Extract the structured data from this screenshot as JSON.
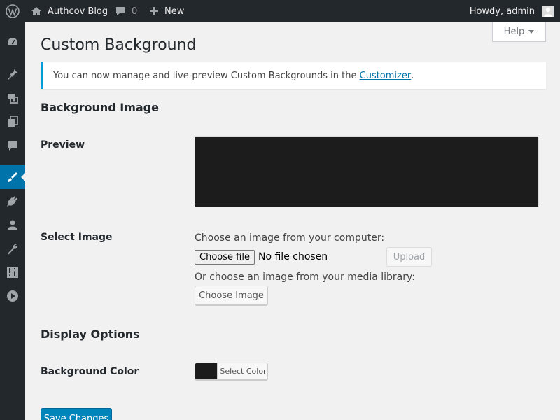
{
  "adminbar": {
    "site_name": "Authcov Blog",
    "comments_count": "0",
    "new_label": "New",
    "howdy": "Howdy, admin"
  },
  "sidebar": {
    "items": [
      {
        "icon": "dashboard-icon"
      },
      {
        "icon": "pin-icon"
      },
      {
        "icon": "media-icon"
      },
      {
        "icon": "pages-icon"
      },
      {
        "icon": "comments-icon"
      },
      {
        "icon": "appearance-icon",
        "active": true
      },
      {
        "icon": "plugins-icon"
      },
      {
        "icon": "users-icon"
      },
      {
        "icon": "tools-icon"
      },
      {
        "icon": "settings-icon"
      },
      {
        "icon": "play-icon"
      }
    ]
  },
  "help": {
    "label": "Help"
  },
  "page": {
    "title": "Custom Background"
  },
  "notice": {
    "text": "You can now manage and live-preview Custom Backgrounds in the ",
    "link": "Customizer",
    "end": "."
  },
  "background_image": {
    "heading": "Background Image",
    "preview_label": "Preview",
    "select_label": "Select Image",
    "from_computer": "Choose an image from your computer:",
    "choose_file": "Choose file",
    "no_file": "No file chosen",
    "upload": "Upload",
    "from_library": "Or choose an image from your media library:",
    "choose_image": "Choose Image"
  },
  "display_options": {
    "heading": "Display Options",
    "bg_color_label": "Background Color",
    "select_color": "Select Color"
  },
  "colors": {
    "accent": "#0073aa",
    "preview_bg": "#1c1c1c",
    "admin_bar": "#23282d"
  },
  "save_label": "Save Changes"
}
